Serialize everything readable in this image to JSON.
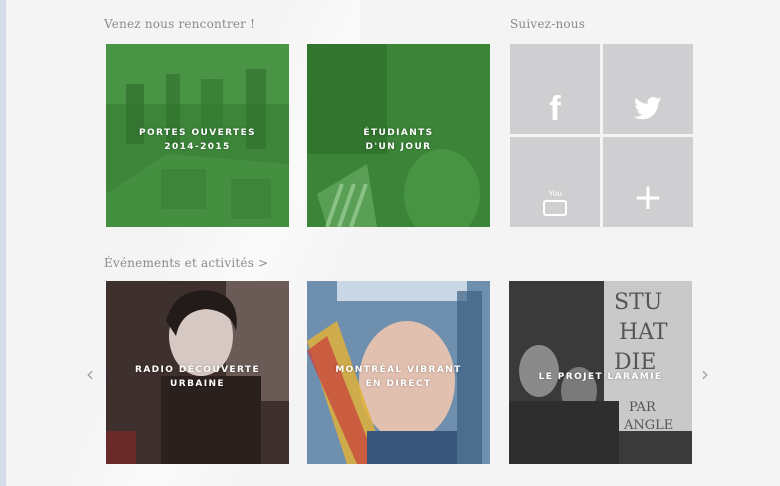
{
  "sections": {
    "meet_title": "Venez nous rencontrer !",
    "follow_title": "Suivez-nous",
    "events_title": "Événements et activités >"
  },
  "visit_tiles": [
    {
      "line1": "PORTES OUVERTES",
      "line2": "2014-2015"
    },
    {
      "line1": "ÉTUDIANTS",
      "line2": "D'UN JOUR"
    }
  ],
  "social": {
    "facebook_glyph": "f",
    "youtube_glyph": "You",
    "plus_glyph": "+"
  },
  "events": [
    {
      "line1": "RADIO DÉCOUVERTE",
      "line2": "URBAINE"
    },
    {
      "line1": "MONTRÉAL VIBRANT",
      "line2": "EN DIRECT"
    },
    {
      "line1": "LE PROJET LARAMIE",
      "line2": ""
    }
  ],
  "carousel": {
    "prev": "‹",
    "next": "›"
  },
  "sign_text": [
    "STU",
    "HAT",
    "DIE",
    "PAR",
    "ANGLE"
  ],
  "colors": {
    "green_overlay": "#3f8a3c",
    "social_tile": "#cfcfd1",
    "background": "#f4f4f5"
  }
}
